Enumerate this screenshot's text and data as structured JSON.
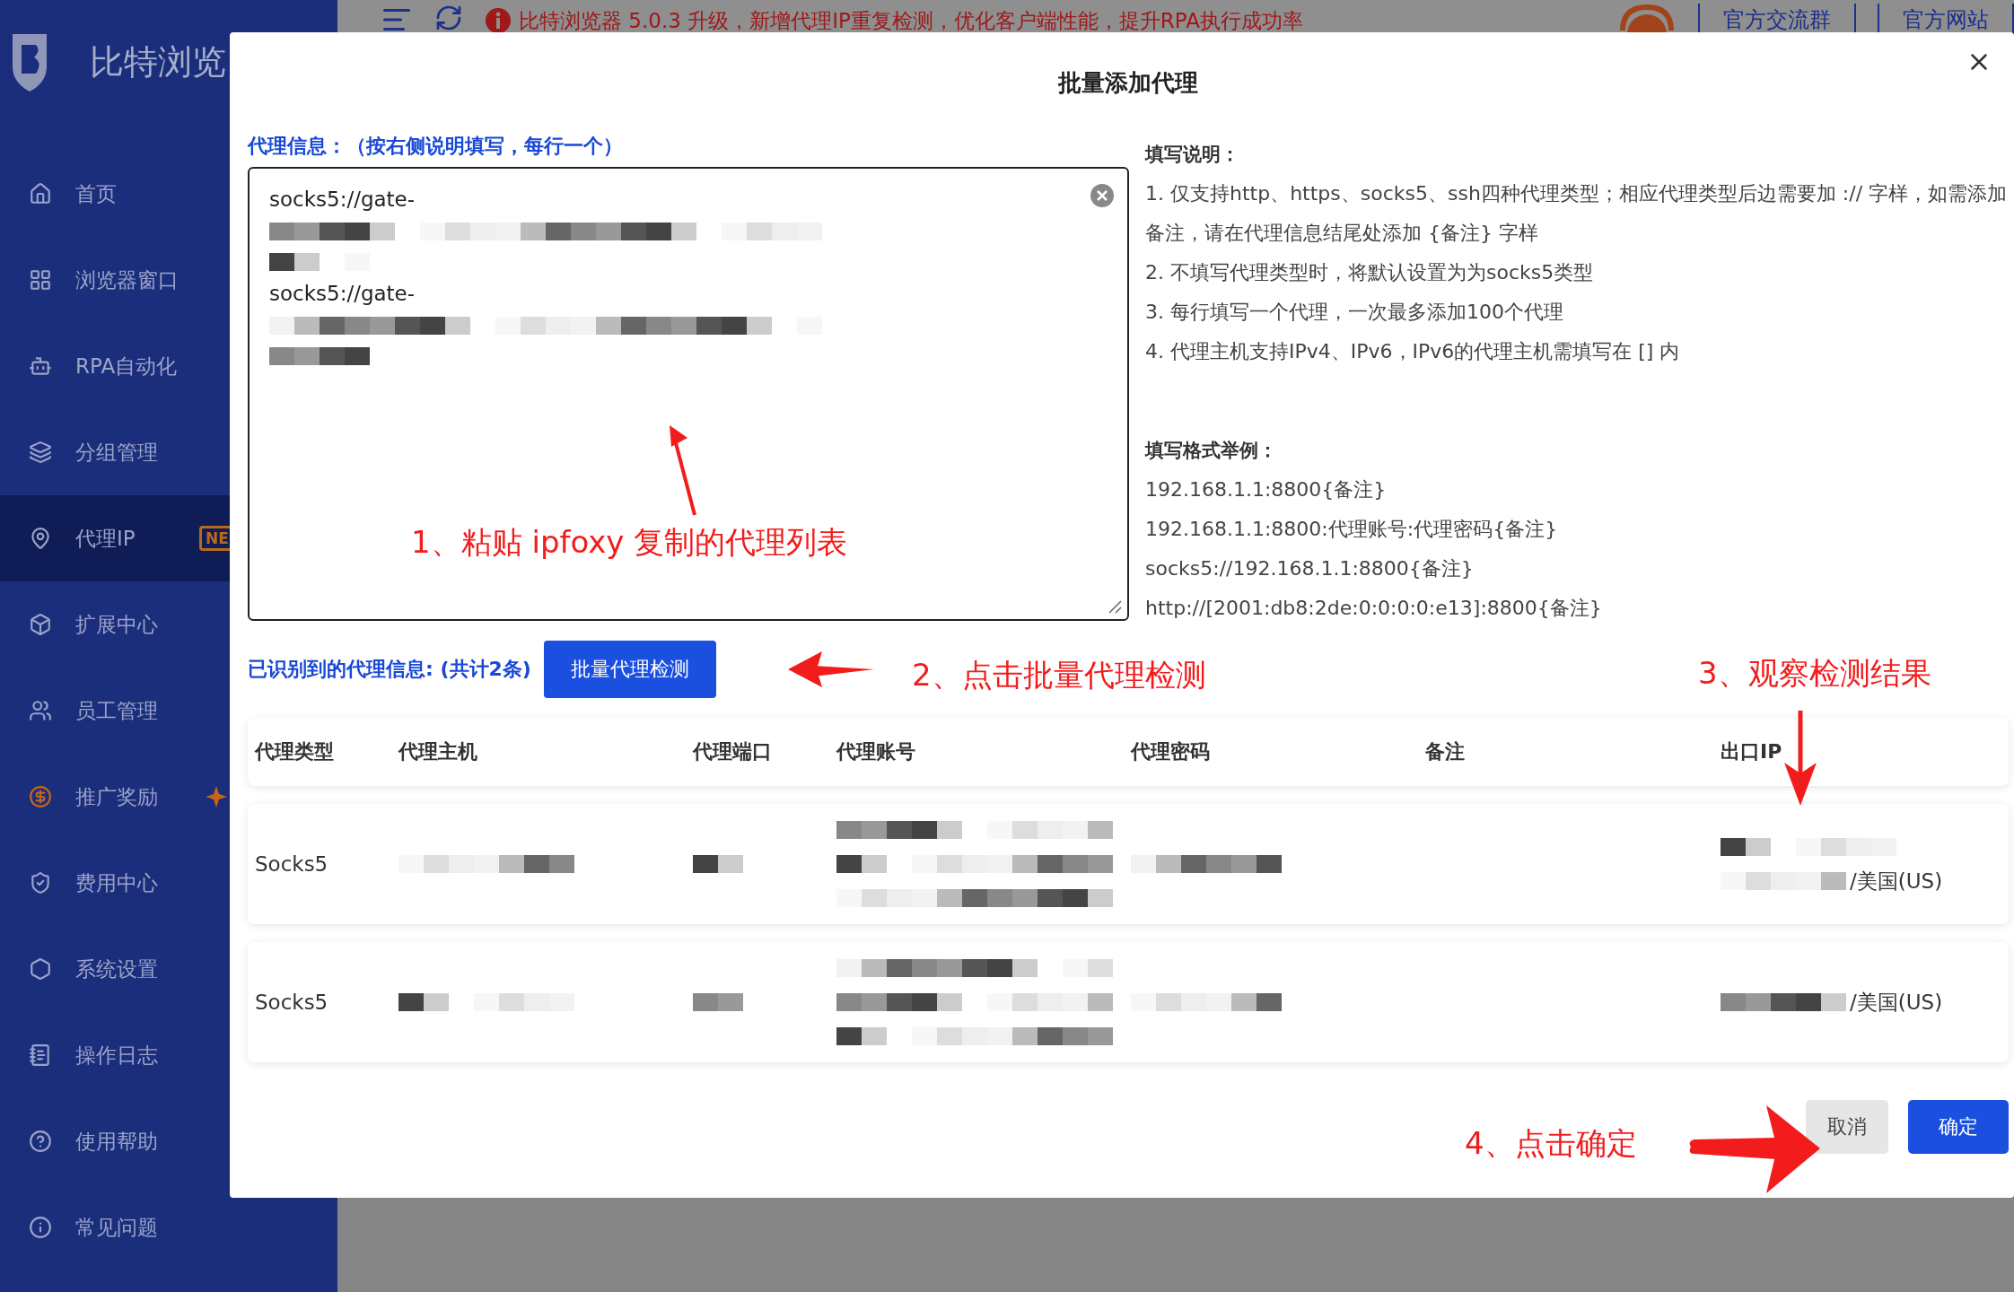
{
  "sidebar": {
    "logo_text": "比特浏览",
    "items": [
      {
        "label": "首页",
        "selected": false
      },
      {
        "label": "浏览器窗口",
        "selected": false
      },
      {
        "label": "RPA自动化",
        "selected": false
      },
      {
        "label": "分组管理",
        "selected": false
      },
      {
        "label": "代理IP",
        "selected": true,
        "badge": "NE"
      },
      {
        "label": "扩展中心",
        "selected": false
      },
      {
        "label": "员工管理",
        "selected": false
      },
      {
        "label": "推广奖励",
        "selected": false
      },
      {
        "label": "费用中心",
        "selected": false
      },
      {
        "label": "系统设置",
        "selected": false
      },
      {
        "label": "操作日志",
        "selected": false
      },
      {
        "label": "使用帮助",
        "selected": false
      },
      {
        "label": "常见问题",
        "selected": false
      }
    ]
  },
  "top_bar": {
    "notice": "比特浏览器 5.0.3 升级，新增代理IP重复检测，优化客户端性能，提升RPA执行成功率",
    "links": [
      "官方交流群",
      "官方网站"
    ]
  },
  "dialog": {
    "title": "批量添加代理",
    "input_label": "代理信息：（按右侧说明填写，每行一个）",
    "input_lines": [
      {
        "text": "socks5://gate-"
      },
      {
        "redacted": true
      },
      {
        "redacted": true
      },
      {
        "text": "socks5://gate-"
      },
      {
        "redacted": true
      },
      {
        "redacted": true
      }
    ],
    "help_title": "填写说明：",
    "help_lines": [
      "1. 仅支持http、https、socks5、ssh四种代理类型；相应代理类型后边需要加 :// 字样，如需添加备注，请在代理信息结尾处添加 {备注} 字样",
      "2. 不填写代理类型时，将默认设置为为socks5类型",
      "3. 每行填写一个代理，一次最多添加100个代理",
      "4. 代理主机支持IPv4、IPv6，IPv6的代理主机需填写在 [] 内"
    ],
    "example_title": "填写格式举例：",
    "example_lines": [
      "192.168.1.1:8800{备注}",
      "192.168.1.1:8800:代理账号:代理密码{备注}",
      "socks5://192.168.1.1:8800{备注}",
      "http://[2001:db8:2de:0:0:0:0:e13]:8800{备注}"
    ],
    "recognized_label": "已识别到的代理信息: (共计2条)",
    "check_button": "批量代理检测",
    "table": {
      "columns": [
        "代理类型",
        "代理主机",
        "代理端口",
        "代理账号",
        "代理密码",
        "备注",
        "出口IP"
      ],
      "rows": [
        {
          "cells": [
            {
              "lines": [
                {
                  "text": "Socks5"
                }
              ]
            },
            {
              "lines": [
                {
                  "redacted": true
                }
              ]
            },
            {
              "lines": [
                {
                  "redacted": true
                }
              ]
            },
            {
              "lines": [
                {
                  "redacted": true
                },
                {
                  "redacted": true
                },
                {
                  "redacted": true
                }
              ]
            },
            {
              "lines": [
                {
                  "redacted": true
                }
              ]
            },
            {},
            {
              "lines": [
                {
                  "redacted": true
                },
                {
                  "redacted": true,
                  "text": "/美国(US)"
                }
              ]
            }
          ]
        },
        {
          "cells": [
            {
              "lines": [
                {
                  "text": "Socks5"
                }
              ]
            },
            {
              "lines": [
                {
                  "redacted": true
                }
              ]
            },
            {
              "lines": [
                {
                  "redacted": true
                }
              ]
            },
            {
              "lines": [
                {
                  "redacted": true
                },
                {
                  "redacted": true
                },
                {
                  "redacted": true
                }
              ]
            },
            {
              "lines": [
                {
                  "redacted": true
                }
              ]
            },
            {},
            {
              "lines": [
                {
                  "redacted": true,
                  "text": "/美国(US)"
                }
              ]
            }
          ]
        }
      ]
    },
    "buttons": [
      {
        "label": "取消",
        "kind": "secondary"
      },
      {
        "label": "确定",
        "kind": "primary"
      }
    ]
  },
  "annotations": [
    "1、粘贴 ipfoxy 复制的代理列表",
    "2、点击批量代理检测",
    "3、观察检测结果",
    "4、点击确定"
  ]
}
